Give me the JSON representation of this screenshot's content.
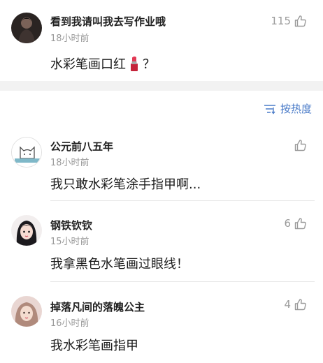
{
  "post": {
    "author": "看到我请叫我去写作业哦",
    "time": "18小时前",
    "likes": "115",
    "content_before": "水彩笔画口红",
    "emoji": "lipstick-icon",
    "content_after": "？"
  },
  "sort": {
    "label": "按热度",
    "icon": "sort-icon"
  },
  "comments": [
    {
      "author": "公元前八五年",
      "time": "18小时前",
      "likes": "",
      "text": "我只敢水彩笔涂手指甲啊..."
    },
    {
      "author": "钢铁钦钦",
      "time": "15小时前",
      "likes": "6",
      "text": "我拿黑色水笔画过眼线！"
    },
    {
      "author": "掉落凡间的落魄公主",
      "time": "16小时前",
      "likes": "4",
      "text": "我水彩笔画指甲"
    }
  ],
  "colors": {
    "accent": "#4a7bc8",
    "muted": "#9a9a9a",
    "separator": "#f2f2f2"
  }
}
